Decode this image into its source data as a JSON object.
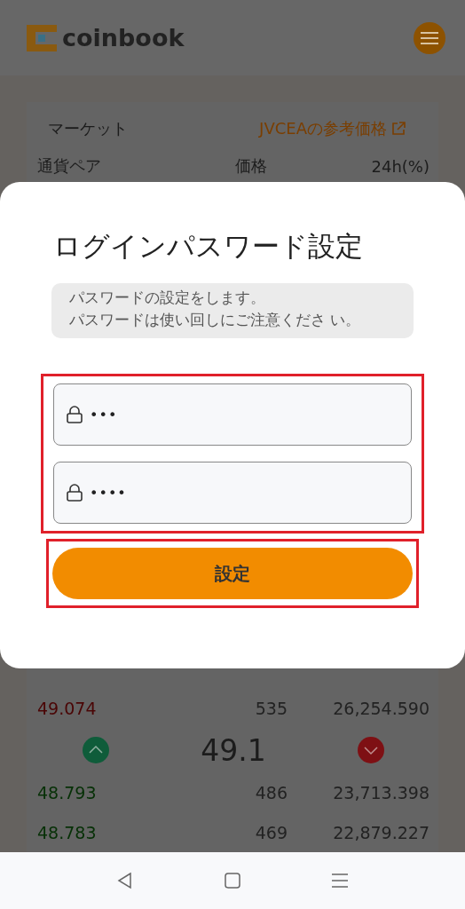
{
  "header": {
    "logo_text": "coinbook"
  },
  "market": {
    "title": "マーケット",
    "link": "JVCEAの参考価格",
    "columns": [
      "通貨ペア",
      "価格",
      "24h(%)"
    ],
    "ask_rows": [
      {
        "price": "49.074",
        "amount": "535",
        "total": "26,254.590"
      }
    ],
    "mid_price": "49.1",
    "bid_rows": [
      {
        "price": "48.793",
        "amount": "486",
        "total": "23,713.398"
      },
      {
        "price": "48.783",
        "amount": "469",
        "total": "22,879.227"
      }
    ]
  },
  "modal": {
    "title": "ログインパスワード設定",
    "notice": [
      "パスワードの設定をします。",
      "パスワードは使い回しにご注意くださ い。"
    ],
    "fields": [
      {
        "value": "•••"
      },
      {
        "value": "••••"
      }
    ],
    "fields_highlighted": true,
    "button": "設定",
    "button_highlighted": true
  }
}
